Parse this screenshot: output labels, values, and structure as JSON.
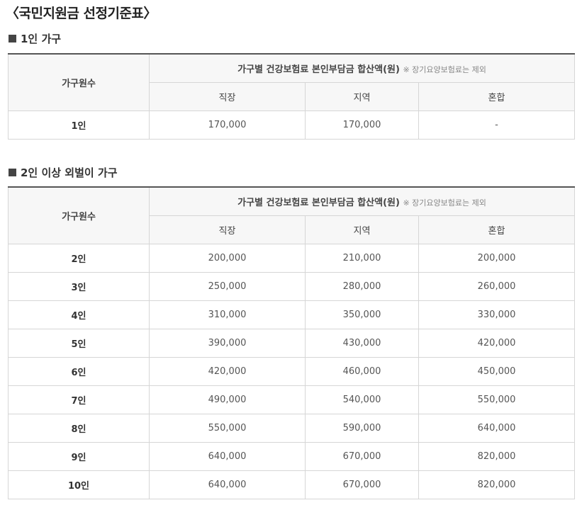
{
  "title": "〈국민지원금 선정기준표〉",
  "section1": {
    "heading": "1인 가구",
    "col_household": "가구원수",
    "col_group": "가구별 건강보험료 본인부담금 합산액(원)",
    "col_group_note": "※ 장기요양보험료는 제외",
    "col_work": "직장",
    "col_region": "지역",
    "col_mixed": "혼합",
    "rows": [
      {
        "label": "1인",
        "work": "170,000",
        "region": "170,000",
        "mixed": "-"
      }
    ]
  },
  "section2": {
    "heading": "2인 이상 외벌이 가구",
    "col_household": "가구원수",
    "col_group": "가구별 건강보험료 본인부담금 합산액(원)",
    "col_group_note": "※ 장기요양보험료는 제외",
    "col_work": "직장",
    "col_region": "지역",
    "col_mixed": "혼합",
    "rows": [
      {
        "label": "2인",
        "work": "200,000",
        "region": "210,000",
        "mixed": "200,000"
      },
      {
        "label": "3인",
        "work": "250,000",
        "region": "280,000",
        "mixed": "260,000"
      },
      {
        "label": "4인",
        "work": "310,000",
        "region": "350,000",
        "mixed": "330,000"
      },
      {
        "label": "5인",
        "work": "390,000",
        "region": "430,000",
        "mixed": "420,000"
      },
      {
        "label": "6인",
        "work": "420,000",
        "region": "460,000",
        "mixed": "450,000"
      },
      {
        "label": "7인",
        "work": "490,000",
        "region": "540,000",
        "mixed": "550,000"
      },
      {
        "label": "8인",
        "work": "550,000",
        "region": "590,000",
        "mixed": "640,000"
      },
      {
        "label": "9인",
        "work": "640,000",
        "region": "670,000",
        "mixed": "820,000"
      },
      {
        "label": "10인",
        "work": "640,000",
        "region": "670,000",
        "mixed": "820,000"
      }
    ]
  }
}
